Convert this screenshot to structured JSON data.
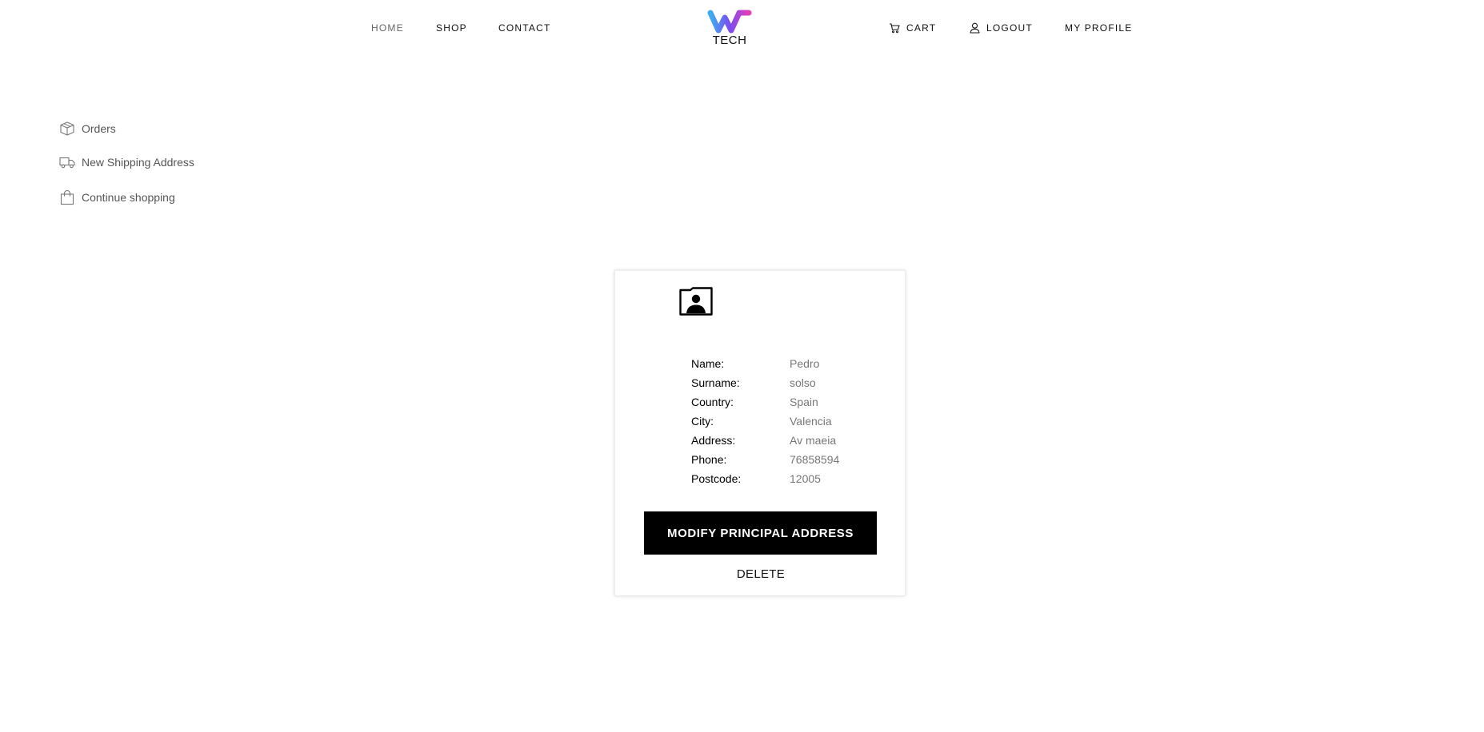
{
  "header": {
    "nav_left": {
      "home": "HOME",
      "shop": "SHOP",
      "contact": "CONTACT"
    },
    "logo_text": "TECH",
    "nav_right": {
      "cart": "CART",
      "logout": "LOGOUT",
      "profile": "MY PROFILE"
    },
    "logo_colors": {
      "start": "#3bb0f0",
      "middle": "#7a4cf0",
      "end": "#e43fb6"
    }
  },
  "sidebar": {
    "items": [
      {
        "label": "Orders",
        "icon": "box-icon"
      },
      {
        "label": "New Shipping Address",
        "icon": "truck-icon"
      },
      {
        "label": "Continue shopping",
        "icon": "shopping-bag-icon"
      }
    ]
  },
  "address_card": {
    "icon": "contact-folder-icon",
    "rows": [
      {
        "label": "Name:",
        "value": "Pedro"
      },
      {
        "label": "Surname:",
        "value": "solso"
      },
      {
        "label": "Country:",
        "value": "Spain"
      },
      {
        "label": "City:",
        "value": "Valencia"
      },
      {
        "label": "Address:",
        "value": "Av maeia"
      },
      {
        "label": "Phone:",
        "value": "76858594"
      },
      {
        "label": "Postcode:",
        "value": "12005"
      }
    ],
    "modify_label": "MODIFY PRINCIPAL ADDRESS",
    "delete_label": "DELETE"
  }
}
